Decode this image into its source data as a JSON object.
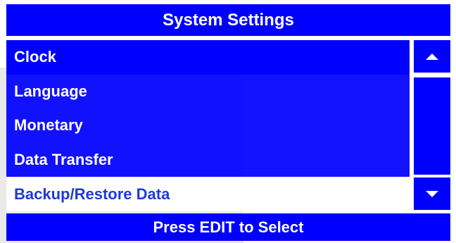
{
  "header": {
    "title": "System Settings"
  },
  "menu": {
    "items": [
      {
        "label": "Clock"
      },
      {
        "label": "Language"
      },
      {
        "label": "Monetary"
      },
      {
        "label": "Data Transfer"
      },
      {
        "label": "Backup/Restore Data"
      }
    ],
    "selected_index": 4
  },
  "scrollbar": {
    "up_icon": "triangle-up-icon",
    "down_icon": "triangle-down-icon"
  },
  "footer": {
    "hint": "Press EDIT to Select"
  },
  "colors": {
    "accent": "#0000ff",
    "selected_text": "#1f3ad8",
    "text": "#ffffff"
  }
}
